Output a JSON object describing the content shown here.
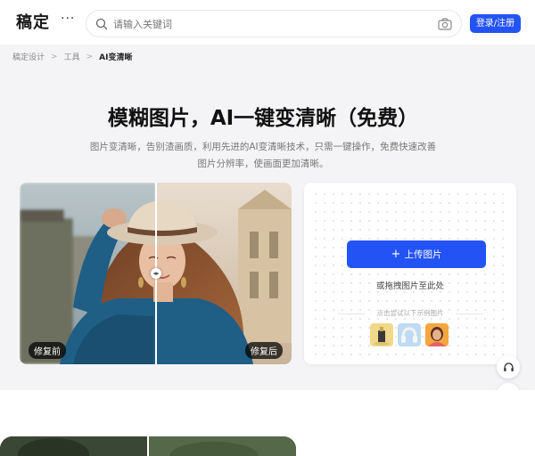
{
  "header": {
    "logo": "稿定",
    "more": "···",
    "search": {
      "placeholder": "请输入关键词",
      "icon": "search-icon",
      "camera_icon": "camera-icon"
    },
    "login_label": "登录/注册"
  },
  "breadcrumb": {
    "items": [
      "稿定设计",
      "工具",
      "AI变清晰"
    ],
    "separator": ">"
  },
  "hero": {
    "title": "模糊图片，AI一键变清晰（免费）",
    "description": "图片变清晰，告别渣画质，利用先进的AI变清晰技术，只需一键操作，免费快速改善图片分辨率，使画面更加清晰。"
  },
  "compare": {
    "before_label": "修复前",
    "after_label": "修复后",
    "divider_position": 0.5
  },
  "upload": {
    "button_label": "上传图片",
    "button_icon": "plus-icon",
    "drag_text": "或拖拽图片至此处",
    "try_text": "点击尝试以下示例图片",
    "samples": [
      "sample-bottle",
      "sample-headphones",
      "sample-portrait"
    ]
  },
  "side_buttons": [
    "headset-icon",
    "grid-icon"
  ],
  "colors": {
    "accent": "#2453f5",
    "background": "#f4f4f6"
  }
}
